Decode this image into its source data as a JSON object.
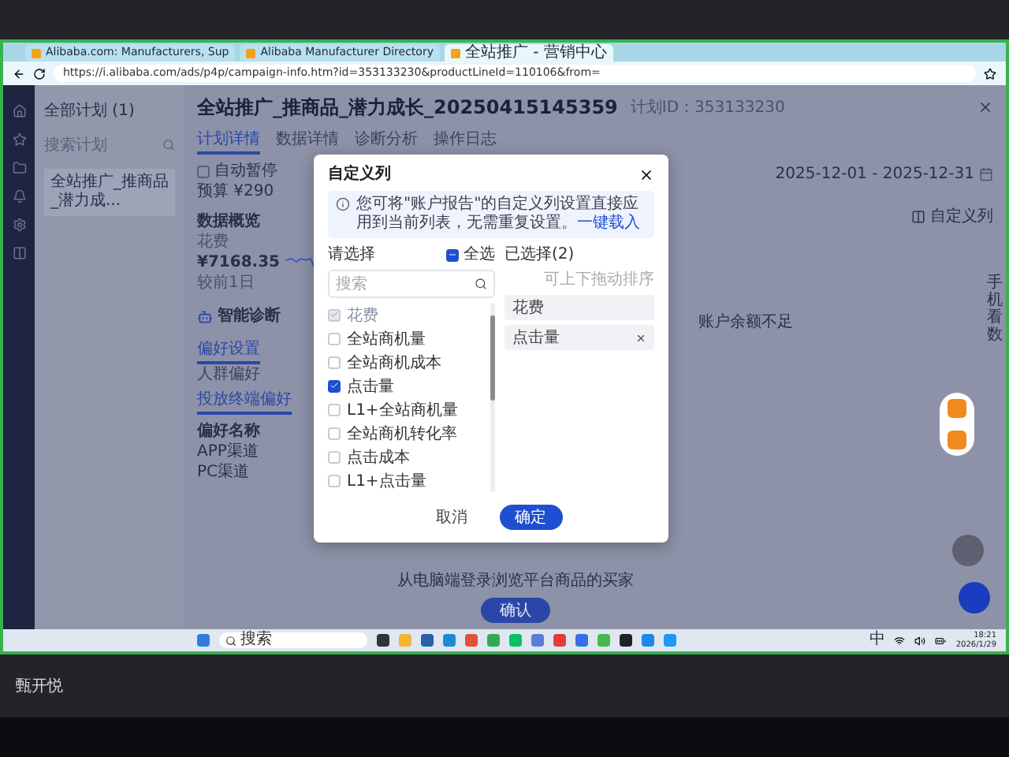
{
  "browser": {
    "tabs": [
      {
        "title": "Alibaba.com: Manufacturers, Sup",
        "selected": false
      },
      {
        "title": "Alibaba Manufacturer Directory",
        "selected": false
      },
      {
        "title": "全站推广 - 营销中心",
        "selected": true
      }
    ],
    "url": "https://i.alibaba.com/ads/p4p/campaign-info.htm?id=353133230&productLineId=110106&from="
  },
  "sidebar": {
    "plan_selector": "全部计划 (1)",
    "search_placeholder": "搜索计划",
    "items": [
      {
        "label": "全站推广_推商品_潜力成...",
        "selected": true
      }
    ]
  },
  "campaign": {
    "title": "全站推广_推商品_潜力成长_20250415145359",
    "plan_id": "计划ID：353133230",
    "tabs": [
      {
        "label": "计划详情",
        "selected": true
      },
      {
        "label": "数据详情",
        "selected": false
      },
      {
        "label": "诊断分析",
        "selected": false
      },
      {
        "label": "操作日志",
        "selected": false
      }
    ],
    "auto_pause": {
      "label": "自动暂停",
      "checked": false
    },
    "budget": "预算 ¥290",
    "date_range": "2025-12-01 - 2025-12-31",
    "custom_columns_link": "自定义列",
    "overview": {
      "title": "数据概览",
      "metric_label": "花费",
      "metric_value": "¥7168.35",
      "comparison": "较前1日"
    },
    "diagnosis": {
      "title": "智能诊断",
      "alert": "账户余额不足"
    },
    "settings_tab": "偏好设置",
    "preference_tabs": [
      {
        "label": "人群偏好",
        "selected": false
      },
      {
        "label": "投放终端偏好",
        "selected": true
      }
    ],
    "table": {
      "columns": [
        "偏好名称"
      ],
      "rows": [
        {
          "name": "APP渠道"
        },
        {
          "name": "PC渠道",
          "description": "从电脑端登录浏览平台商品的买家"
        }
      ]
    },
    "confirm_button": "确认",
    "side_widget": "手机看数"
  },
  "modal": {
    "title": "自定义列",
    "info": "您可将\"账户报告\"的自定义列设置直接应用到当前列表，无需重复设置。",
    "info_link": "一键载入",
    "select_label": "请选择",
    "select_all": {
      "label": "全选",
      "indeterminate": true
    },
    "search_placeholder": "搜索",
    "options": [
      {
        "label": "花费",
        "checked": true,
        "disabled": true
      },
      {
        "label": "全站商机量",
        "checked": false,
        "disabled": false
      },
      {
        "label": "全站商机成本",
        "checked": false,
        "disabled": false
      },
      {
        "label": "点击量",
        "checked": true,
        "disabled": false
      },
      {
        "label": "L1+全站商机量",
        "checked": false,
        "disabled": false
      },
      {
        "label": "全站商机转化率",
        "checked": false,
        "disabled": false
      },
      {
        "label": "点击成本",
        "checked": false,
        "disabled": false
      },
      {
        "label": "L1+点击量",
        "checked": false,
        "disabled": false
      }
    ],
    "selected_title": "已选择(2)",
    "sort_hint": "可上下拖动排序",
    "selected_items": [
      {
        "label": "花费",
        "removable": false
      },
      {
        "label": "点击量",
        "removable": true
      }
    ],
    "buttons": [
      {
        "label": "取消",
        "kind": "secondary"
      },
      {
        "label": "确定",
        "kind": "primary"
      }
    ]
  },
  "taskbar": {
    "search_placeholder": "搜索",
    "ime": "中",
    "time": "18:21",
    "date": "2026/1/29"
  },
  "meeting_label": "甄开悦"
}
